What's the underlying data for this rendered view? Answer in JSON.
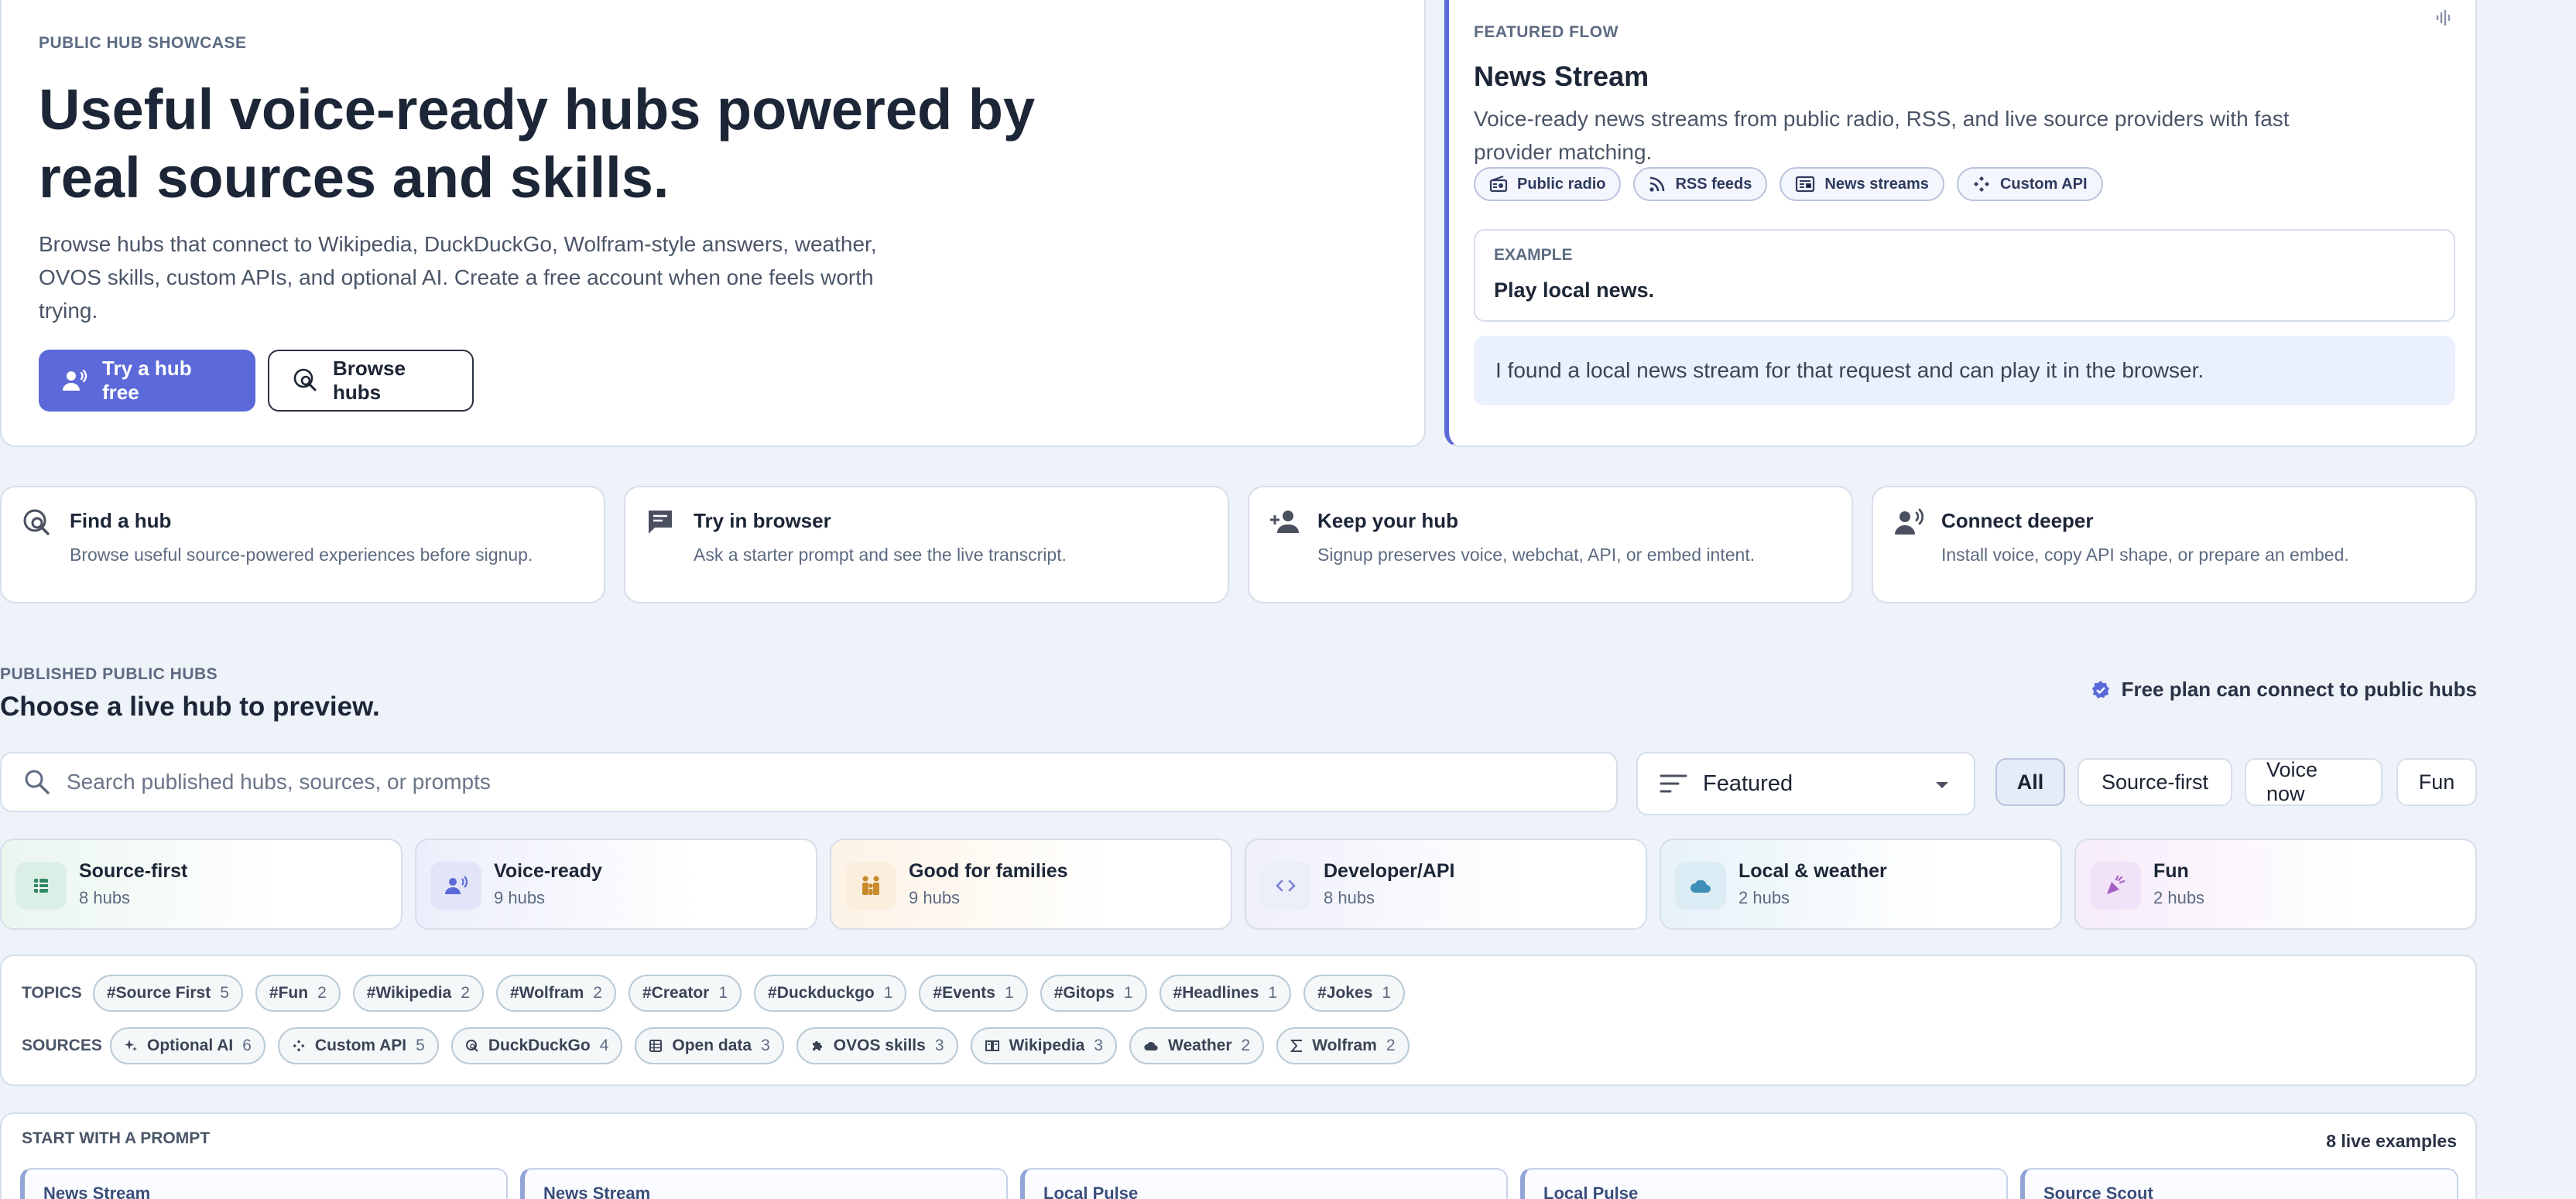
{
  "hero": {
    "eyebrow": "PUBLIC HUB SHOWCASE",
    "title": "Useful voice-ready hubs powered by real sources and skills.",
    "description": "Browse hubs that connect to Wikipedia, DuckDuckGo, Wolfram-style answers, weather, OVOS skills, custom APIs, and optional AI. Create a free account when one feels worth trying.",
    "primary_button": "Try a hub free",
    "secondary_button": "Browse hubs"
  },
  "featured": {
    "eyebrow": "FEATURED FLOW",
    "title": "News Stream",
    "description": "Voice-ready news streams from public radio, RSS, and live source providers with fast provider matching.",
    "chips": [
      {
        "label": "Public radio",
        "icon": "radio-icon"
      },
      {
        "label": "RSS feeds",
        "icon": "rss-icon"
      },
      {
        "label": "News streams",
        "icon": "newspaper-icon"
      },
      {
        "label": "Custom API",
        "icon": "api-icon"
      }
    ],
    "example_label": "EXAMPLE",
    "example_text": "Play local news.",
    "response": "I found a local news stream for that request and can play it in the browser."
  },
  "steps": [
    {
      "title": "Find a hub",
      "desc": "Browse useful source-powered experiences before signup.",
      "icon": "travel-explore-icon"
    },
    {
      "title": "Try in browser",
      "desc": "Ask a starter prompt and see the live transcript.",
      "icon": "chat-icon"
    },
    {
      "title": "Keep your hub",
      "desc": "Signup preserves voice, webchat, API, or embed intent.",
      "icon": "person-add-icon"
    },
    {
      "title": "Connect deeper",
      "desc": "Install voice, copy API shape, or prepare an embed.",
      "icon": "voice-person-icon"
    }
  ],
  "published": {
    "eyebrow": "PUBLISHED PUBLIC HUBS",
    "title": "Choose a live hub to preview.",
    "free_plan": "Free plan can connect to public hubs"
  },
  "search": {
    "placeholder": "Search published hubs, sources, or prompts"
  },
  "sort": {
    "selected": "Featured"
  },
  "filters": [
    "All",
    "Source-first",
    "Voice now",
    "Fun"
  ],
  "categories": [
    {
      "title": "Source-first",
      "count": "8 hubs",
      "icon": "table-icon",
      "color": "#2f8a63",
      "bg": "#e3f3ec"
    },
    {
      "title": "Voice-ready",
      "count": "9 hubs",
      "icon": "voice-icon",
      "color": "#5b6ad8",
      "bg": "#e7e9fa"
    },
    {
      "title": "Good for families",
      "count": "9 hubs",
      "icon": "family-icon",
      "color": "#c78a2c",
      "bg": "#fbeedd"
    },
    {
      "title": "Developer/API",
      "count": "8 hubs",
      "icon": "code-icon",
      "color": "#7a83d6",
      "bg": "#eceefa"
    },
    {
      "title": "Local & weather",
      "count": "2 hubs",
      "icon": "cloud-icon",
      "color": "#3f8fb8",
      "bg": "#e1f0f7"
    },
    {
      "title": "Fun",
      "count": "2 hubs",
      "icon": "party-icon",
      "color": "#a45fc6",
      "bg": "#f3e6f8"
    }
  ],
  "topics_label": "TOPICS",
  "topics": [
    {
      "label": "#Source First",
      "count": "5"
    },
    {
      "label": "#Fun",
      "count": "2"
    },
    {
      "label": "#Wikipedia",
      "count": "2"
    },
    {
      "label": "#Wolfram",
      "count": "2"
    },
    {
      "label": "#Creator",
      "count": "1"
    },
    {
      "label": "#Duckduckgo",
      "count": "1"
    },
    {
      "label": "#Events",
      "count": "1"
    },
    {
      "label": "#Gitops",
      "count": "1"
    },
    {
      "label": "#Headlines",
      "count": "1"
    },
    {
      "label": "#Jokes",
      "count": "1"
    }
  ],
  "sources_label": "SOURCES",
  "sources": [
    {
      "label": "Optional AI",
      "count": "6",
      "icon": "sparkle-icon"
    },
    {
      "label": "Custom API",
      "count": "5",
      "icon": "api-icon"
    },
    {
      "label": "DuckDuckGo",
      "count": "4",
      "icon": "search-icon"
    },
    {
      "label": "Open data",
      "count": "3",
      "icon": "table-icon"
    },
    {
      "label": "OVOS skills",
      "count": "3",
      "icon": "puzzle-icon"
    },
    {
      "label": "Wikipedia",
      "count": "3",
      "icon": "book-icon"
    },
    {
      "label": "Weather",
      "count": "2",
      "icon": "cloud-icon"
    },
    {
      "label": "Wolfram",
      "count": "2",
      "icon": "sigma-icon"
    }
  ],
  "prompts": {
    "eyebrow": "START WITH A PROMPT",
    "count": "8 live examples",
    "cards": [
      "News Stream",
      "News Stream",
      "Local Pulse",
      "Local Pulse",
      "Source Scout"
    ]
  },
  "colors": {
    "accent": "#5b6ad8",
    "background": "#eef2f9"
  }
}
